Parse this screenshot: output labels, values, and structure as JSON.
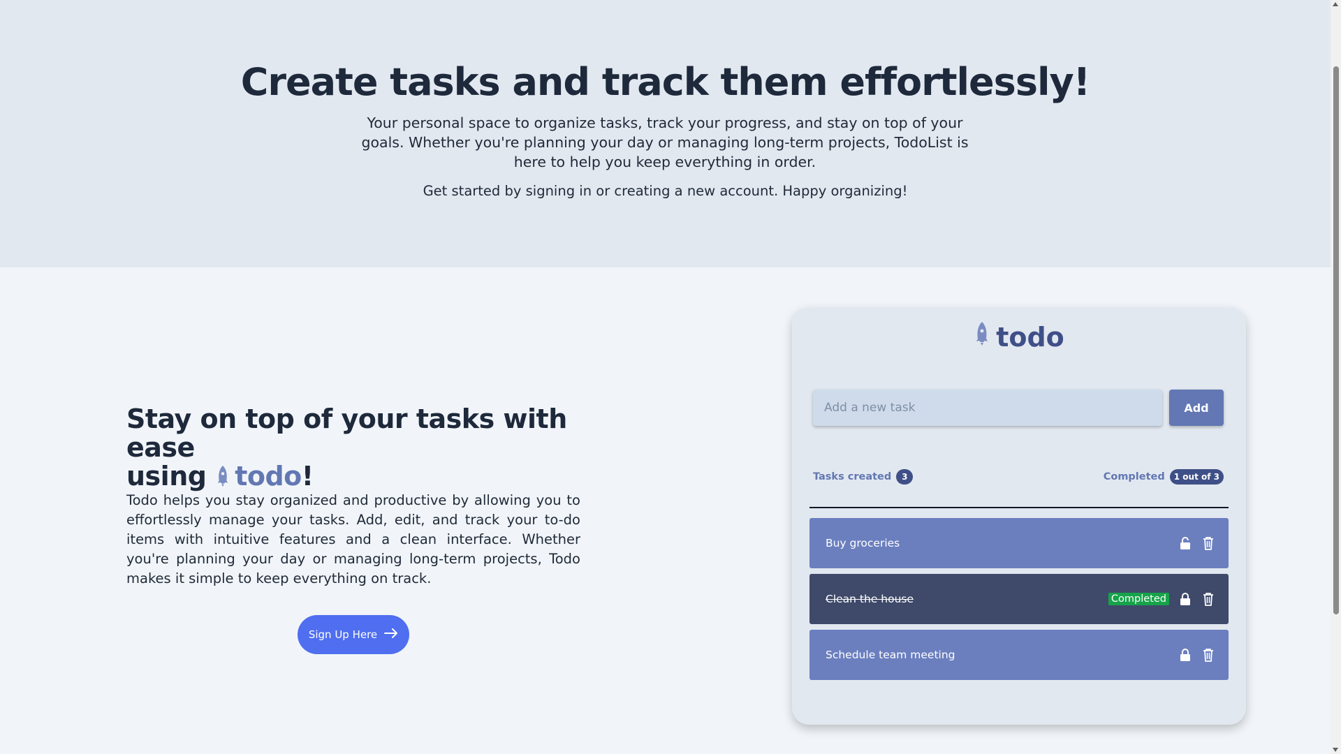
{
  "hero": {
    "title": "Create tasks and track them effortlessly!",
    "lead": "Your personal space to organize tasks, track your progress, and stay on top of your goals. Whether you're planning your day or managing long-term projects, TodoList is here to help you keep everything in order.",
    "sub": "Get started by signing in or creating a new account. Happy organizing!"
  },
  "promo": {
    "title_line": "Stay on top of your tasks with ease",
    "title_using": "using",
    "brand": "todo",
    "exclaim": "!",
    "description": "Todo helps you stay organized and productive by allowing you to effortlessly manage your tasks. Add, edit, and track your to-do items with intuitive features and a clean interface. Whether you're planning your day or managing long-term projects, Todo makes it simple to keep everything on track.",
    "signup_label": "Sign Up Here"
  },
  "card": {
    "brand": "todo",
    "input_placeholder": "Add a new task",
    "input_value": "",
    "add_label": "Add",
    "tasks_created_label": "Tasks created",
    "tasks_created_count": "3",
    "completed_label": "Completed",
    "completed_count": "1 out of 3",
    "tasks": [
      {
        "title": "Buy groceries",
        "completed": false,
        "lock_icon": "unlock-icon"
      },
      {
        "title": "Clean the house",
        "completed": true,
        "status": "Completed",
        "lock_icon": "lock-icon"
      },
      {
        "title": "Schedule team meeting",
        "completed": false,
        "lock_icon": "lock-icon"
      }
    ]
  },
  "colors": {
    "accent": "#6277b3",
    "brand_dark": "#3f4f87",
    "signup": "#4f6ef0",
    "completed_tag": "#16a34a"
  }
}
